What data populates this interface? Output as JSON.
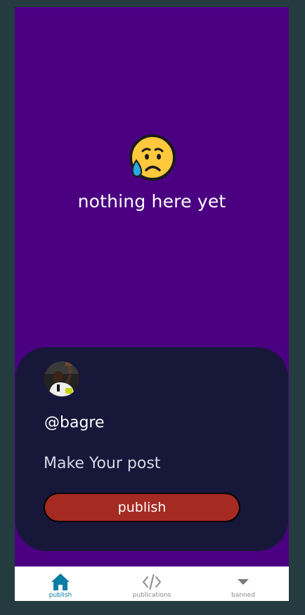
{
  "empty_state": {
    "emoji": "sad-but-relieved-face",
    "message": "nothing here yet"
  },
  "composer": {
    "username": "@bagre",
    "post_placeholder": "Make Your post",
    "publish_label": "publish"
  },
  "nav": {
    "items": [
      {
        "label": "publish",
        "icon": "home-icon",
        "active": true
      },
      {
        "label": "publications",
        "icon": "code-icon",
        "active": false
      },
      {
        "label": "banned",
        "icon": "caret-down-icon",
        "active": false
      }
    ]
  },
  "colors": {
    "page_background": "#243b40",
    "app_background": "#4b0082",
    "composer_background": "#17173a",
    "publish_button": "#a52a22",
    "nav_active": "#0b7ea3",
    "nav_inactive": "#8a8a8a"
  }
}
